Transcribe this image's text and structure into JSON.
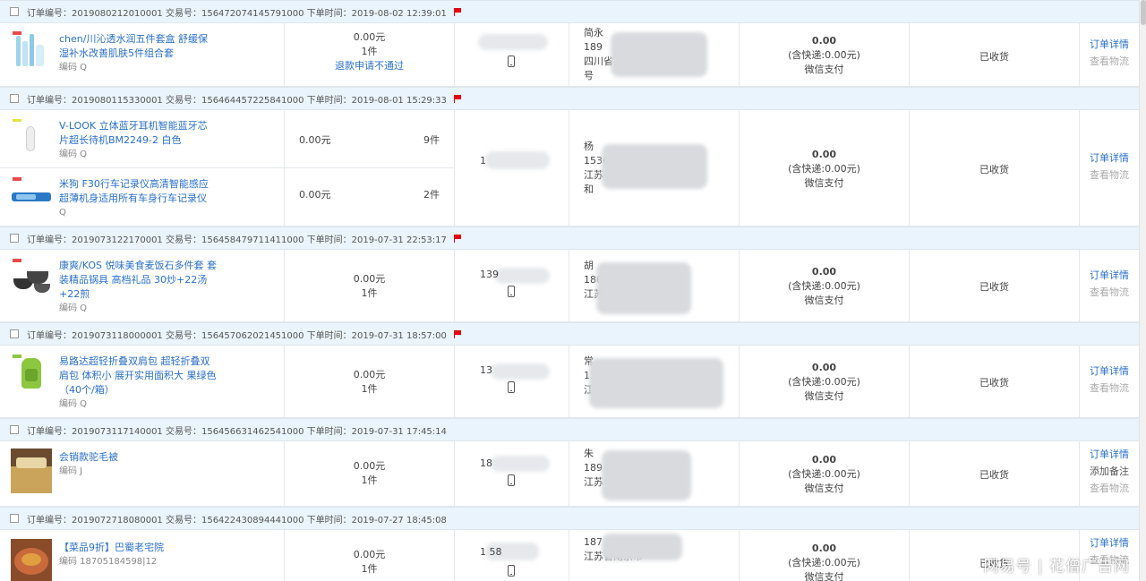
{
  "orders": [
    {
      "header": "订单编号：2019080212010001 交易号：156472074145791000    下单时间：2019-08-02 12:39:01",
      "products": [
        {
          "name": "chen/川沁透水润五件套盒 舒缓保湿补水改善肌肤5件组合套",
          "code": "编码 Q"
        }
      ],
      "prices": [
        {
          "amount": "0.00元",
          "qty": "1件",
          "note": "退款申请不通过"
        }
      ],
      "buyer": "",
      "address": [
        "简永",
        "189",
        "四川省                    47",
        "号"
      ],
      "payment": {
        "total": "0.00",
        "shipping": "(含快递:0.00元)",
        "method": "微信支付"
      },
      "status": "已收货",
      "actions": [
        "订单详情",
        "查看物流"
      ]
    },
    {
      "header": "订单编号：2019080115330001 交易号：156464457225841000    下单时间：2019-08-01 15:29:33",
      "products": [
        {
          "name": "V-LOOK 立体蓝牙耳机智能蓝牙芯片超长待机BM2249-2 白色",
          "code": "编码 Q"
        },
        {
          "name": "米狗 F30行车记录仪高清智能感应超薄机身适用所有车身行车记录仪",
          "code": "Q"
        }
      ],
      "prices": [
        {
          "amount": "0.00元",
          "qty": "9件"
        },
        {
          "amount": "0.00元",
          "qty": "2件"
        }
      ],
      "buyer": "1",
      "address": [
        "杨",
        "1536",
        "江苏省南京          区南海生物",
        "和"
      ],
      "payment": {
        "total": "0.00",
        "shipping": "(含快递:0.00元)",
        "method": "微信支付"
      },
      "status": "已收货",
      "actions": [
        "订单详情",
        "查看物流"
      ]
    },
    {
      "header": "订单编号：2019073122170001 交易号：156458479711411000    下单时间：2019-07-31 22:53:17",
      "products": [
        {
          "name": "康爽/KOS 悦味美食麦饭石多件套 套装精品锅具 高档礼品 30炒+22汤+22煎",
          "code": "编码 Q"
        }
      ],
      "prices": [
        {
          "amount": "0.00元",
          "qty": "1件"
        }
      ],
      "buyer": "139",
      "address": [
        "胡",
        "180         590",
        "江苏省          区新秋湖东路",
        ""
      ],
      "payment": {
        "total": "0.00",
        "shipping": "(含快递:0.00元)",
        "method": "微信支付"
      },
      "status": "已收货",
      "actions": [
        "订单详情",
        "查看物流"
      ]
    },
    {
      "header": "订单编号：2019073118000001 交易号：156457062021451000    下单时间：2019-07-31 18:57:00",
      "products": [
        {
          "name": "易路达超轻折叠双肩包 超轻折叠双肩包 体积小 展开实用面积大 果绿色 （40个/箱）",
          "code": "编码 Q"
        }
      ],
      "prices": [
        {
          "amount": "0.00元",
          "qty": "1件"
        }
      ],
      "buyer": "13",
      "address": [
        "常",
        "137",
        "江",
        ""
      ],
      "payment": {
        "total": "0.00",
        "shipping": "(含快递:0.00元)",
        "method": "微信支付"
      },
      "status": "已收货",
      "actions": [
        "订单详情",
        "查看物流"
      ]
    },
    {
      "header": "订单编号：2019073117140001 交易号：156456631462541000    下单时间：2019-07-31 17:45:14",
      "products": [
        {
          "name": "会销款驼毛被",
          "code": "编码 J"
        }
      ],
      "prices": [
        {
          "amount": "0.00元",
          "qty": "1件"
        }
      ],
      "buyer": "18",
      "address": [
        "朱",
        "189",
        "江苏               中路",
        ""
      ],
      "payment": {
        "total": "0.00",
        "shipping": "(含快递:0.00元)",
        "method": "微信支付"
      },
      "status": "已收货",
      "actions": [
        "订单详情",
        "添加备注",
        "查看物流"
      ]
    },
    {
      "header": "订单编号：2019072718080001 交易号：156422430894441000    下单时间：2019-07-27 18:45:08",
      "products": [
        {
          "name": "【菜品9折】巴蜀老宅院",
          "code": "编码 18705184598|12"
        }
      ],
      "prices": [
        {
          "amount": "0.00元",
          "qty": "1件"
        }
      ],
      "buyer": "1              58",
      "address": [
        "",
        "187",
        "江苏省南京市",
        ""
      ],
      "payment": {
        "total": "0.00",
        "shipping": "(含快递:0.00元)",
        "method": "微信支付"
      },
      "status": "已收货",
      "actions": [
        "订单详情",
        "查看物流"
      ]
    }
  ],
  "watermark": "网易号 | 花僧广告网",
  "icons": {
    "checkbox": "checkbox-icon",
    "flag": "red-flag-icon",
    "phone": "mobile-phone-icon"
  },
  "colors": {
    "header_bg": "#eaf4fc",
    "link": "#2a6fc9",
    "flag": "#e60012"
  }
}
